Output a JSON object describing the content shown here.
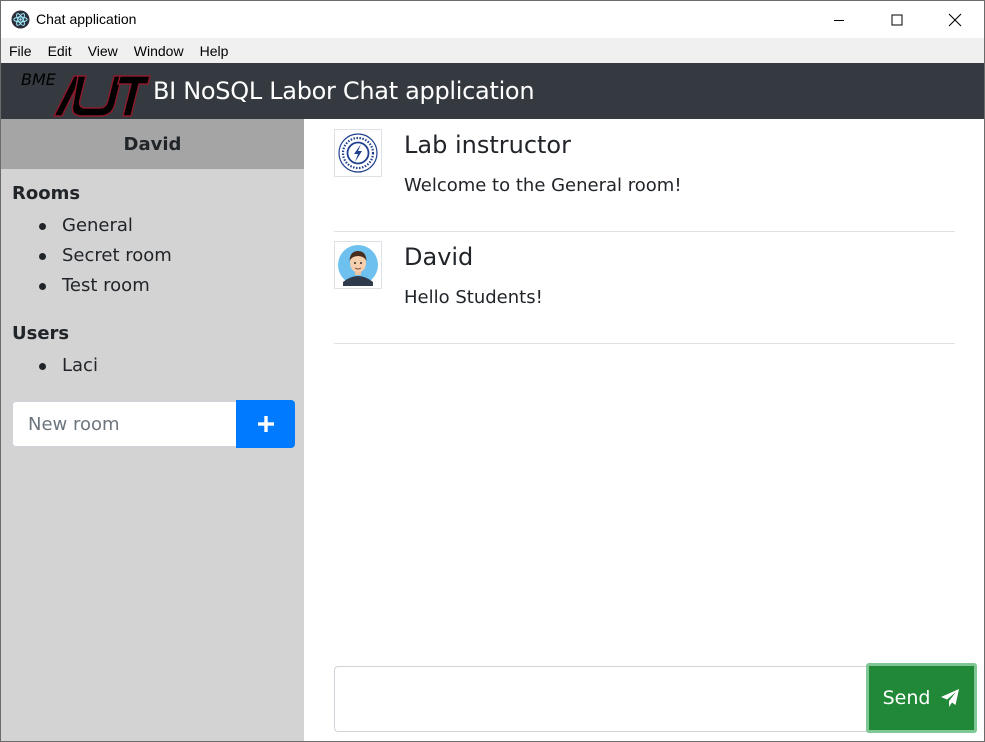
{
  "window": {
    "title": "Chat application"
  },
  "menu": {
    "items": [
      "File",
      "Edit",
      "View",
      "Window",
      "Help"
    ]
  },
  "header": {
    "logo_text": "BME",
    "title": "BI NoSQL Labor Chat application"
  },
  "sidebar": {
    "current_user": "David",
    "rooms_title": "Rooms",
    "rooms": [
      "General",
      "Secret room",
      "Test room"
    ],
    "users_title": "Users",
    "users": [
      "Laci"
    ],
    "new_room_placeholder": "New room"
  },
  "messages": [
    {
      "author": "Lab instructor",
      "text": "Welcome to the General room!",
      "avatar": "university-seal-icon"
    },
    {
      "author": "David",
      "text": "Hello Students!",
      "avatar": "user-avatar-icon"
    }
  ],
  "composer": {
    "value": "",
    "send_label": "Send"
  },
  "colors": {
    "header_bg": "#343a40",
    "sidebar_bg": "#d3d3d3",
    "user_header_bg": "#a5a5a5",
    "primary": "#007bff",
    "success": "#218838",
    "logo": "#8b1a2b"
  }
}
